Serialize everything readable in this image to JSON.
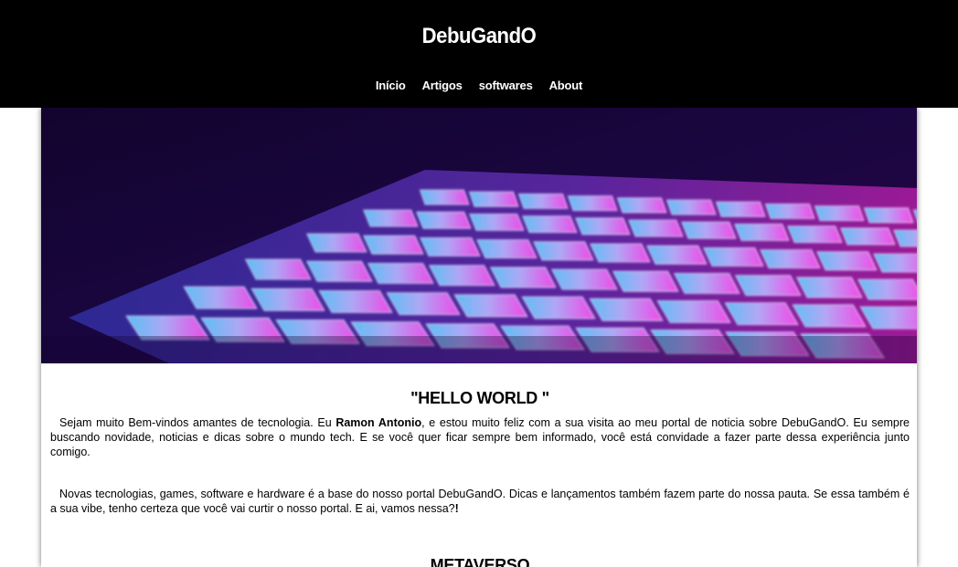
{
  "header": {
    "brand": "DebuGandO",
    "nav": [
      "Início",
      "Artigos",
      "softwares",
      "About"
    ]
  },
  "hero": {
    "subject": "illuminated keyboard",
    "colors": [
      "#1a0640",
      "#6a6cff",
      "#f044ff"
    ]
  },
  "main": {
    "heading": "\"HELLO WORLD \"",
    "intro": {
      "before": "Sejam muito Bem-vindos amantes de tecnologia. Eu ",
      "author": "Ramon Antonio",
      "after": ", e estou muito feliz com a sua visita ao meu portal de noticia sobre DebuGandO. Eu sempre buscando novidade, noticias e dicas sobre o mundo tech. E se você quer ficar sempre bem informado, você está convidade a fazer parte dessa experiência junto comigo."
    },
    "second": {
      "text": "Novas tecnologias, games, software e hardware é a base do nosso portal DebuGandO. Dicas e lançamentos também fazem parte do nossa pauta. Se essa também é a sua vibe, tenho certeza que você vai curtir o nosso portal. E ai, vamos nessa?",
      "end": "!"
    },
    "section_title": "METAVERSO"
  }
}
